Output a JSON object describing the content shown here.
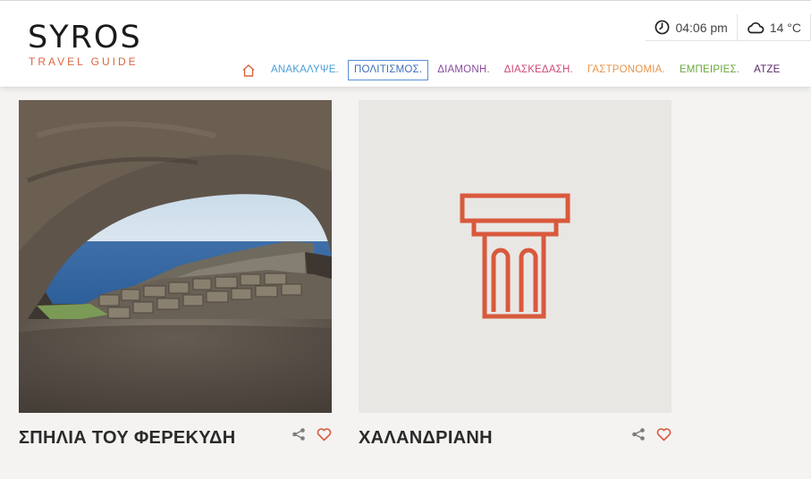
{
  "logo": {
    "title": "SYROS",
    "subtitle": "TRAVEL GUIDE"
  },
  "info": {
    "time": "04:06 pm",
    "temperature": "14 °C"
  },
  "nav": [
    {
      "label": "ΑΝΑΚΑΛΥΨΕ.",
      "color": "#4a9fd8",
      "active": false
    },
    {
      "label": "ΠΟΛΙΤΙΣΜΟΣ.",
      "color": "#3c6fb8",
      "active": true
    },
    {
      "label": "ΔΙΑΜΟΝΗ.",
      "color": "#8a4a9e",
      "active": false
    },
    {
      "label": "ΔΙΑΣΚΕΔΑΣΗ.",
      "color": "#d04a7a",
      "active": false
    },
    {
      "label": "ΓΑΣΤΡΟΝΟΜΙΑ.",
      "color": "#e8944a",
      "active": false
    },
    {
      "label": "ΕΜΠΕΙΡΙΕΣ.",
      "color": "#6aa83c",
      "active": false
    },
    {
      "label": "ΑΤΖΕ",
      "color": "#5a2a6a",
      "active": false
    }
  ],
  "cards": [
    {
      "title": "ΣΠΗΛΙΑ ΤΟΥ ΦΕΡΕΚΥΔΗ"
    },
    {
      "title": "ΧΑΛΑΝΔΡΙΑΝΗ"
    }
  ],
  "colors": {
    "brand": "#d9653f",
    "column_icon": "#d9593d",
    "placeholder_bg": "#e8e7e4"
  },
  "icons": [
    "home-icon",
    "clock-icon",
    "cloud-icon",
    "share-icon",
    "heart-icon",
    "column-icon"
  ]
}
